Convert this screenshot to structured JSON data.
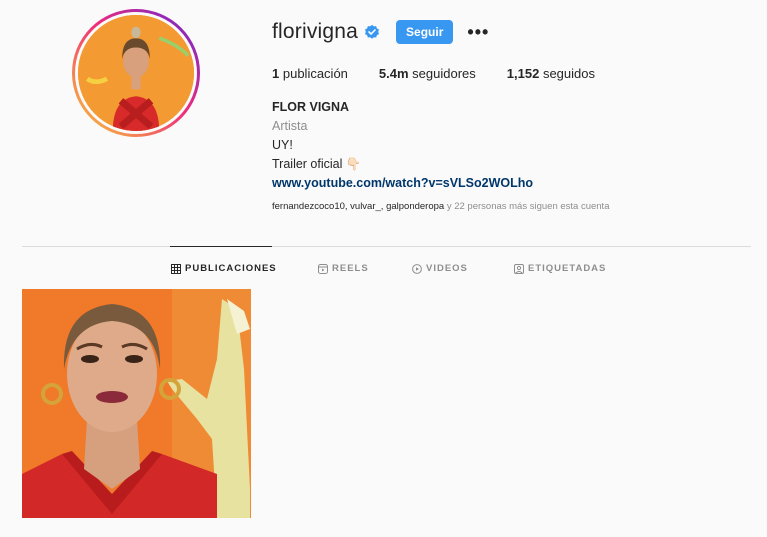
{
  "profile": {
    "username": "florivigna",
    "follow_label": "Seguir",
    "more_label": "•••",
    "fullname": "FLOR VIGNA",
    "category": "Artista",
    "bio_lines": [
      "UY!",
      "Trailer oficial 👇🏻"
    ],
    "link": "www.youtube.com/watch?v=sVLSo2WOLho"
  },
  "stats": {
    "posts_value": "1",
    "posts_label": "publicación",
    "followers_value": "5.4m",
    "followers_label": "seguidores",
    "following_value": "1,152",
    "following_label": "seguidos"
  },
  "followed_by": {
    "names": "fernandezcoco10, vulvar_, galponderopa",
    "suffix": "y 22 personas más siguen esta cuenta"
  },
  "tabs": [
    {
      "label": "PUBLICACIONES",
      "icon": "grid-icon",
      "active": true
    },
    {
      "label": "REELS",
      "icon": "reels-icon",
      "active": false
    },
    {
      "label": "VIDEOS",
      "icon": "video-icon",
      "active": false
    },
    {
      "label": "ETIQUETADAS",
      "icon": "tagged-icon",
      "active": false
    }
  ],
  "colors": {
    "follow_button": "#3897f0",
    "verified": "#3897f0",
    "link": "#00376b",
    "story_ring_start": "#f9ce34",
    "story_ring_end": "#6228d7"
  }
}
